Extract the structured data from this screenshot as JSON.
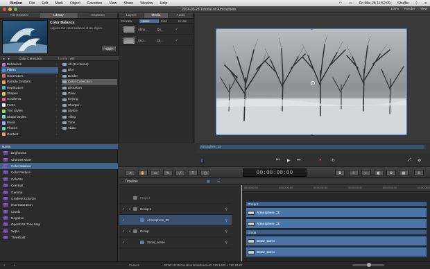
{
  "menubar": {
    "app_name": "Motion",
    "items": [
      "File",
      "Edit",
      "Mark",
      "Object",
      "Favorites",
      "View",
      "Share",
      "Window",
      "Help"
    ],
    "clock": "Fri Mar 28  11:52:09",
    "user": "Shuffle"
  },
  "window": {
    "title": "2014-03-28 Tutorial on Atmosphere",
    "zoom": "100%",
    "render_label": "Render",
    "view_label": "View"
  },
  "left_tabs": [
    "File Browser",
    "Library",
    "Inspector"
  ],
  "mid_tabs": [
    "Layers",
    "Media",
    "Audio"
  ],
  "library": {
    "preview_title": "Color Balance",
    "preview_desc": "Adjusts the color balance of an object.",
    "apply_label": "Apply",
    "category_header": "Color Correction",
    "theme_label": "Theme",
    "theme_value": "All",
    "categories": [
      "Behaviors",
      "Filters",
      "Generators",
      "Particle Emitters",
      "Replicators",
      "Shapes",
      "Gradients",
      "Fonts",
      "Text Styles",
      "Shape Styles",
      "Music",
      "Photos",
      "Content"
    ],
    "subcategories": [
      "All (114 items)",
      "Blur",
      "Border",
      "Color Correction",
      "Distortion",
      "Glow",
      "Keying",
      "Sharpen",
      "Stylize",
      "Tiling",
      "Time",
      "Video"
    ]
  },
  "media_list": {
    "headers": [
      "Preview",
      "Name",
      "Kind",
      "In Use"
    ],
    "rows": [
      {
        "name": "Atmo...",
        "kind": "Qu...",
        "in_use": "✓"
      },
      {
        "name": "Sno...",
        "kind": "Sti...",
        "in_use": "✓"
      }
    ]
  },
  "filters_list": {
    "header": "Name",
    "items": [
      "Brightness",
      "Channel Mixer",
      "Color Balance",
      "Color Reduce",
      "Colorize",
      "Contrast",
      "Gamma",
      "Gradient Colorize",
      "Hue/Saturation",
      "Levels",
      "Negative",
      "OpenEXR Tone Map",
      "Sepia",
      "Threshold"
    ]
  },
  "mini_timeline": {
    "clip_label": "Atmosphere_28"
  },
  "toolbar": {
    "timecode": "00:00:00:00"
  },
  "timeline": {
    "title": "Timeline",
    "ruler_ticks": [
      "00:00:00:00",
      "00:00:01:00",
      "00:00:02:00",
      "00:00:03:00",
      "00:00:04:00",
      "00:00:05:00"
    ],
    "layers": [
      {
        "name": "Project",
        "checked": false,
        "indent": 0
      },
      {
        "name": "Group 1",
        "checked": true,
        "indent": 0
      },
      {
        "name": "Atmosphere_28",
        "checked": true,
        "indent": 1
      },
      {
        "name": "Group",
        "checked": true,
        "indent": 0
      },
      {
        "name": "Snow_scene",
        "checked": true,
        "indent": 1
      }
    ],
    "bars": [
      {
        "label": "Group 1"
      },
      {
        "label": "Atmosphere_28"
      },
      {
        "label": "Atmosphere_28"
      },
      {
        "label": "Group"
      },
      {
        "label": "Snow_scene"
      },
      {
        "label": "Snow_scene"
      }
    ],
    "footer_label": "Custom"
  },
  "status_bar": "00:00:10:29  Duration  Broadcast HD 720  1280 × 720  29.97",
  "colors": {
    "accent": "#3f6289",
    "selection": "#36506e",
    "bar": "#4a6c95"
  },
  "icons": [
    "apple-icon",
    "wifi-icon",
    "battery-icon",
    "search-icon",
    "list-icon",
    "gear-icon",
    "play-icon",
    "record-icon"
  ]
}
